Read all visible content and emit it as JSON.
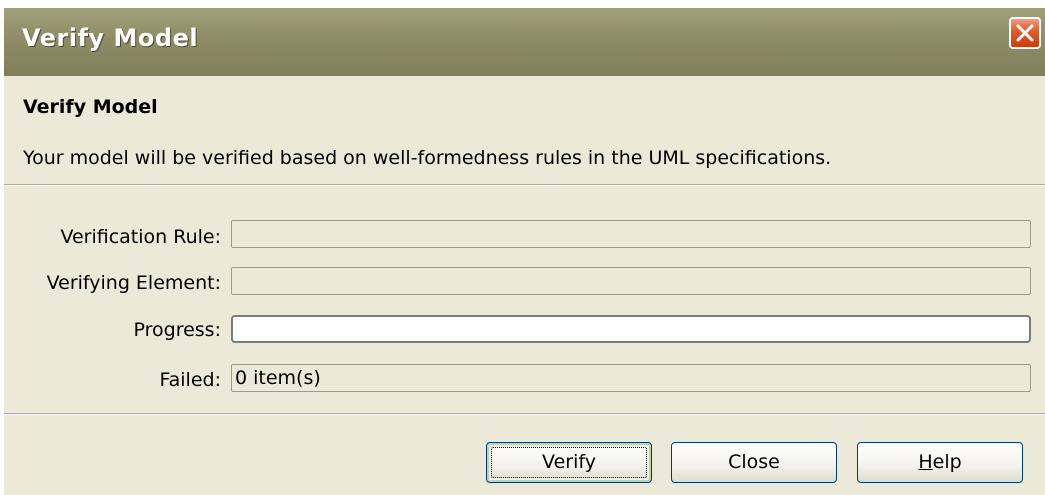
{
  "window": {
    "title": "Verify Model"
  },
  "header": {
    "title": "Verify Model",
    "description": "Your model will be verified based on well-formedness rules in the UML specifications."
  },
  "fields": {
    "verification_rule": {
      "label": "Verification Rule:",
      "value": ""
    },
    "verifying_element": {
      "label": "Verifying Element:",
      "value": ""
    },
    "progress": {
      "label": "Progress:",
      "value": ""
    },
    "failed": {
      "label": "Failed:",
      "value": "0 item(s)"
    }
  },
  "buttons": {
    "verify": "Verify",
    "close": "Close",
    "help_prefix": "H",
    "help_rest": "elp"
  },
  "icons": {
    "close": "close-icon"
  },
  "colors": {
    "titlebar": "#8c8b65",
    "close_button": "#e05a2a",
    "dialog_background": "#ece9d8"
  }
}
